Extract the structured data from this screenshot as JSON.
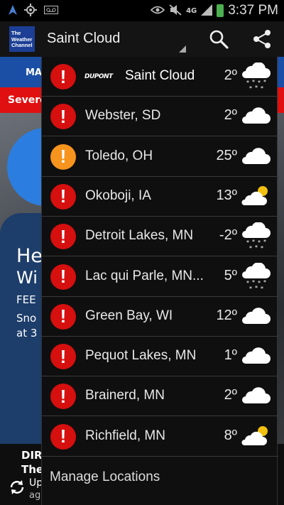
{
  "statusbar": {
    "time": "3:37 PM",
    "network": "4G"
  },
  "appbar": {
    "logo_text": "The Weather Channel",
    "location_title": "Saint Cloud"
  },
  "background": {
    "nav_label": "MA",
    "alert_label": "Severe",
    "headline_1": "He",
    "headline_2": "Wi",
    "sub_1": "FEE",
    "sub_2": "Sno",
    "sub_3": "at 3",
    "bottom_1": "DIR",
    "bottom_2": "The",
    "bottom_3": "Up",
    "bottom_4": "ag"
  },
  "locations": [
    {
      "city": "Saint Cloud",
      "temp": "2º",
      "alert": "warning",
      "sponsor": "DUPONT",
      "icon": "snow-cloud-icon"
    },
    {
      "city": "Webster, SD",
      "temp": "2º",
      "alert": "warning",
      "icon": "cloud-icon"
    },
    {
      "city": "Toledo, OH",
      "temp": "25º",
      "alert": "advisory",
      "icon": "cloud-icon"
    },
    {
      "city": "Okoboji, IA",
      "temp": "13º",
      "alert": "warning",
      "icon": "partly-cloudy-icon"
    },
    {
      "city": "Detroit Lakes, MN",
      "temp": "-2º",
      "alert": "warning",
      "icon": "snow-cloud-icon"
    },
    {
      "city": "Lac qui Parle, MN...",
      "temp": "5º",
      "alert": "warning",
      "icon": "snow-cloud-icon"
    },
    {
      "city": "Green Bay, WI",
      "temp": "12º",
      "alert": "warning",
      "icon": "cloud-icon"
    },
    {
      "city": "Pequot Lakes, MN",
      "temp": "1º",
      "alert": "warning",
      "icon": "cloud-icon"
    },
    {
      "city": "Brainerd, MN",
      "temp": "2º",
      "alert": "warning",
      "icon": "cloud-icon"
    },
    {
      "city": "Richfield, MN",
      "temp": "8º",
      "alert": "warning",
      "icon": "partly-cloudy-icon"
    }
  ],
  "manage_label": "Manage Locations",
  "colors": {
    "warning": "#d60f0f",
    "advisory": "#f7941d",
    "nav_blue": "#1b4fa5",
    "alert_red": "#e01010"
  }
}
